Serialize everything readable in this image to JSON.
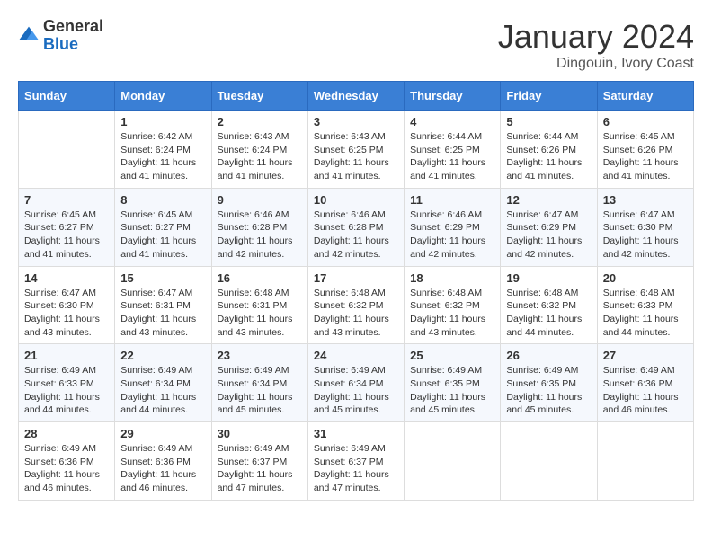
{
  "logo": {
    "general": "General",
    "blue": "Blue"
  },
  "title": "January 2024",
  "location": "Dingouin, Ivory Coast",
  "days_of_week": [
    "Sunday",
    "Monday",
    "Tuesday",
    "Wednesday",
    "Thursday",
    "Friday",
    "Saturday"
  ],
  "weeks": [
    [
      {
        "day": "",
        "info": ""
      },
      {
        "day": "1",
        "info": "Sunrise: 6:42 AM\nSunset: 6:24 PM\nDaylight: 11 hours and 41 minutes."
      },
      {
        "day": "2",
        "info": "Sunrise: 6:43 AM\nSunset: 6:24 PM\nDaylight: 11 hours and 41 minutes."
      },
      {
        "day": "3",
        "info": "Sunrise: 6:43 AM\nSunset: 6:25 PM\nDaylight: 11 hours and 41 minutes."
      },
      {
        "day": "4",
        "info": "Sunrise: 6:44 AM\nSunset: 6:25 PM\nDaylight: 11 hours and 41 minutes."
      },
      {
        "day": "5",
        "info": "Sunrise: 6:44 AM\nSunset: 6:26 PM\nDaylight: 11 hours and 41 minutes."
      },
      {
        "day": "6",
        "info": "Sunrise: 6:45 AM\nSunset: 6:26 PM\nDaylight: 11 hours and 41 minutes."
      }
    ],
    [
      {
        "day": "7",
        "info": "Sunrise: 6:45 AM\nSunset: 6:27 PM\nDaylight: 11 hours and 41 minutes."
      },
      {
        "day": "8",
        "info": "Sunrise: 6:45 AM\nSunset: 6:27 PM\nDaylight: 11 hours and 41 minutes."
      },
      {
        "day": "9",
        "info": "Sunrise: 6:46 AM\nSunset: 6:28 PM\nDaylight: 11 hours and 42 minutes."
      },
      {
        "day": "10",
        "info": "Sunrise: 6:46 AM\nSunset: 6:28 PM\nDaylight: 11 hours and 42 minutes."
      },
      {
        "day": "11",
        "info": "Sunrise: 6:46 AM\nSunset: 6:29 PM\nDaylight: 11 hours and 42 minutes."
      },
      {
        "day": "12",
        "info": "Sunrise: 6:47 AM\nSunset: 6:29 PM\nDaylight: 11 hours and 42 minutes."
      },
      {
        "day": "13",
        "info": "Sunrise: 6:47 AM\nSunset: 6:30 PM\nDaylight: 11 hours and 42 minutes."
      }
    ],
    [
      {
        "day": "14",
        "info": "Sunrise: 6:47 AM\nSunset: 6:30 PM\nDaylight: 11 hours and 43 minutes."
      },
      {
        "day": "15",
        "info": "Sunrise: 6:47 AM\nSunset: 6:31 PM\nDaylight: 11 hours and 43 minutes."
      },
      {
        "day": "16",
        "info": "Sunrise: 6:48 AM\nSunset: 6:31 PM\nDaylight: 11 hours and 43 minutes."
      },
      {
        "day": "17",
        "info": "Sunrise: 6:48 AM\nSunset: 6:32 PM\nDaylight: 11 hours and 43 minutes."
      },
      {
        "day": "18",
        "info": "Sunrise: 6:48 AM\nSunset: 6:32 PM\nDaylight: 11 hours and 43 minutes."
      },
      {
        "day": "19",
        "info": "Sunrise: 6:48 AM\nSunset: 6:32 PM\nDaylight: 11 hours and 44 minutes."
      },
      {
        "day": "20",
        "info": "Sunrise: 6:48 AM\nSunset: 6:33 PM\nDaylight: 11 hours and 44 minutes."
      }
    ],
    [
      {
        "day": "21",
        "info": "Sunrise: 6:49 AM\nSunset: 6:33 PM\nDaylight: 11 hours and 44 minutes."
      },
      {
        "day": "22",
        "info": "Sunrise: 6:49 AM\nSunset: 6:34 PM\nDaylight: 11 hours and 44 minutes."
      },
      {
        "day": "23",
        "info": "Sunrise: 6:49 AM\nSunset: 6:34 PM\nDaylight: 11 hours and 45 minutes."
      },
      {
        "day": "24",
        "info": "Sunrise: 6:49 AM\nSunset: 6:34 PM\nDaylight: 11 hours and 45 minutes."
      },
      {
        "day": "25",
        "info": "Sunrise: 6:49 AM\nSunset: 6:35 PM\nDaylight: 11 hours and 45 minutes."
      },
      {
        "day": "26",
        "info": "Sunrise: 6:49 AM\nSunset: 6:35 PM\nDaylight: 11 hours and 45 minutes."
      },
      {
        "day": "27",
        "info": "Sunrise: 6:49 AM\nSunset: 6:36 PM\nDaylight: 11 hours and 46 minutes."
      }
    ],
    [
      {
        "day": "28",
        "info": "Sunrise: 6:49 AM\nSunset: 6:36 PM\nDaylight: 11 hours and 46 minutes."
      },
      {
        "day": "29",
        "info": "Sunrise: 6:49 AM\nSunset: 6:36 PM\nDaylight: 11 hours and 46 minutes."
      },
      {
        "day": "30",
        "info": "Sunrise: 6:49 AM\nSunset: 6:37 PM\nDaylight: 11 hours and 47 minutes."
      },
      {
        "day": "31",
        "info": "Sunrise: 6:49 AM\nSunset: 6:37 PM\nDaylight: 11 hours and 47 minutes."
      },
      {
        "day": "",
        "info": ""
      },
      {
        "day": "",
        "info": ""
      },
      {
        "day": "",
        "info": ""
      }
    ]
  ]
}
